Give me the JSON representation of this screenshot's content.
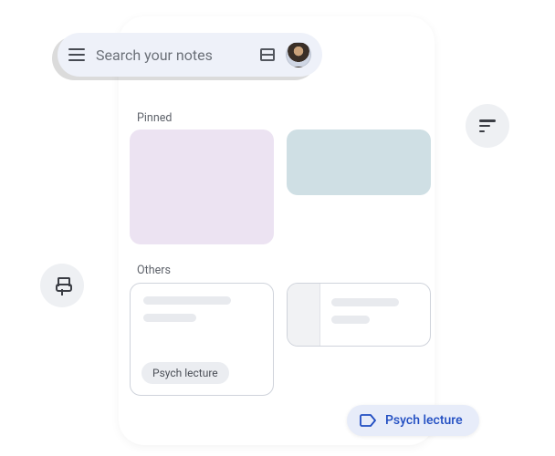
{
  "search": {
    "placeholder": "Search your notes"
  },
  "sections": {
    "pinned_label": "Pinned",
    "others_label": "Others"
  },
  "pinned": [
    {
      "color": "#ece3f2"
    },
    {
      "color": "#cfdfe4"
    }
  ],
  "others_card_chip": "Psych lecture",
  "floating_label_pill": "Psych lecture",
  "icons": {
    "menu": "menu-icon",
    "layout": "layout-toggle-icon",
    "avatar": "user-avatar",
    "pin": "pin-icon",
    "sort": "sort-icon",
    "label": "label-outline-icon"
  },
  "colors": {
    "accent": "#204dc2",
    "pill_bg": "#e7ecf9",
    "search_bg": "#eef1f9"
  }
}
